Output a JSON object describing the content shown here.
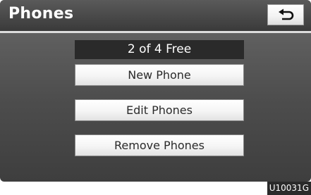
{
  "header": {
    "title": "Phones"
  },
  "icons": {
    "back": "return-arrow-icon"
  },
  "status": {
    "text": "2 of 4 Free"
  },
  "menu": {
    "items": [
      {
        "label": "New Phone"
      },
      {
        "label": "Edit Phones"
      },
      {
        "label": "Remove Phones"
      }
    ]
  },
  "footer": {
    "figure_code": "U10031G"
  },
  "colors": {
    "header_bg": "#3a3a3a",
    "screen_bg": "#4d4d4d",
    "status_bg": "#2a2a2a",
    "button_bg": "#f5f5f5"
  }
}
